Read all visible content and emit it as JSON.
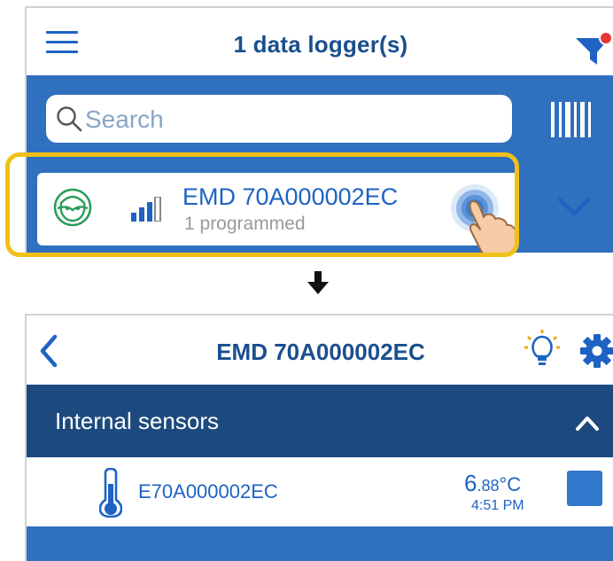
{
  "list_screen": {
    "title": "1 data logger(s)",
    "search": {
      "placeholder": "Search"
    },
    "logger": {
      "name": "EMD 70A000002EC",
      "status": "1 programmed"
    },
    "icons": [
      "menu-icon",
      "filter-icon",
      "search-icon",
      "barcode-scan-icon",
      "logger-avatar-icon",
      "signal-strength-icon",
      "tap-gesture-icon",
      "chevron-down-icon"
    ]
  },
  "transition": {
    "icon": "arrow-down-icon"
  },
  "detail_screen": {
    "title": "EMD 70A000002EC",
    "section": {
      "title": "Internal sensors",
      "expanded": true
    },
    "sensor": {
      "id": "E70A000002EC",
      "temp_int": "6",
      "temp_dec": ".88",
      "temp_unit": "°C",
      "time": "4:51 PM",
      "color": "#2f78cc"
    },
    "icons": [
      "back-chevron-icon",
      "lightbulb-icon",
      "gear-icon",
      "chevron-up-icon",
      "thermometer-icon"
    ]
  },
  "colors": {
    "brand_blue": "#2f70bf",
    "dark_blue": "#1c4a7e",
    "title_blue": "#1a4f8f",
    "highlight_yellow": "#f0c018",
    "avatar_green": "#2a9d5a",
    "filter_dot_red": "#e53935"
  }
}
